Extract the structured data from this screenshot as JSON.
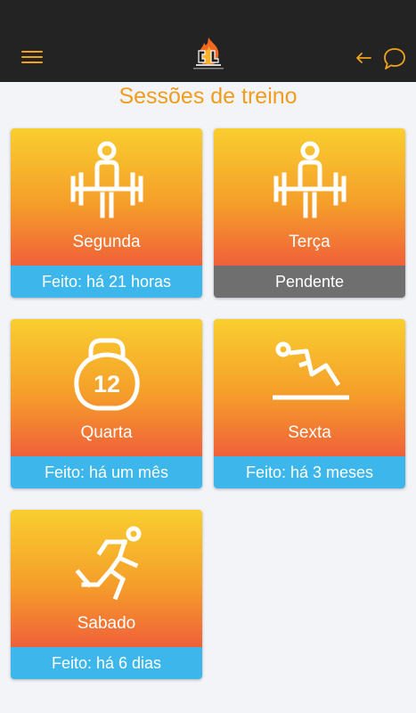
{
  "colors": {
    "appbar": "#232323",
    "accent": "#ee9d1c",
    "card_gradient": [
      "#f9ce2f",
      "#f59e2a",
      "#f0603a"
    ],
    "status_done": "#3db6ec",
    "status_pending": "#6f6f6f",
    "background": "#f3f4f8"
  },
  "appbar": {
    "menu_icon": "hamburger-menu-icon",
    "logo": "flame-logo",
    "back_icon": "arrow-left-icon",
    "chat_icon": "speech-bubble-icon"
  },
  "page": {
    "title": "Sessões de treino"
  },
  "sessions": [
    {
      "label": "Segunda",
      "status": "Feito: há 21 horas",
      "state": "done",
      "icon": "weightlifter-icon"
    },
    {
      "label": "Terça",
      "status": "Pendente",
      "state": "pending",
      "icon": "weightlifter-icon"
    },
    {
      "label": "Quarta",
      "status": "Feito: há um mês",
      "state": "done",
      "icon": "kettlebell-icon",
      "icon_text": "12"
    },
    {
      "label": "Sexta",
      "status": "Feito: há 3 meses",
      "state": "done",
      "icon": "situp-icon"
    },
    {
      "label": "Sabado",
      "status": "Feito: há 6 dias",
      "state": "done",
      "icon": "runner-icon"
    }
  ]
}
